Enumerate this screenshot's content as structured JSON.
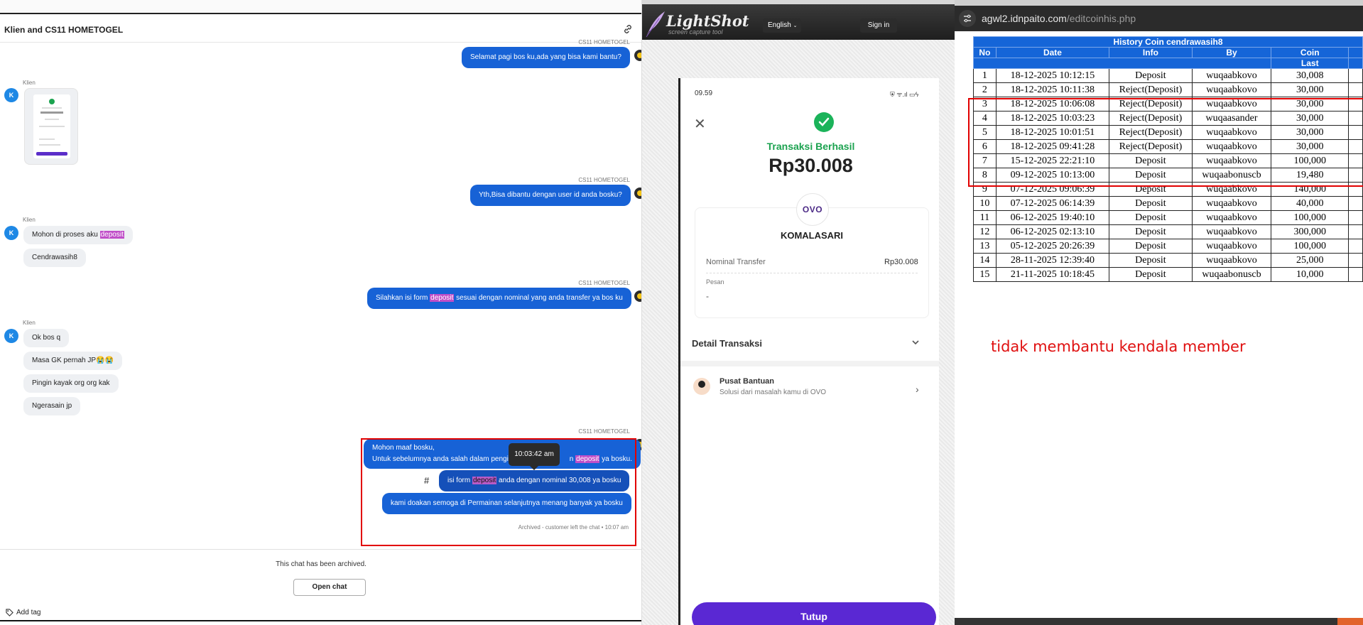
{
  "chat": {
    "title": "Klien and CS11 HOMETOGEL",
    "agent_name": "CS11 HOMETOGEL",
    "client_name": "Klien",
    "avatar_letter": "K",
    "msg1": "Selamat pagi bos ku,ada yang bisa kami bantu?",
    "msg2": "Yth,Bisa dibantu dengan user id anda bosku?",
    "msg3_pre": "Mohon di proses aku ",
    "msg3_hl": "deposit",
    "msg4": "Cendrawasih8",
    "msg5_pre": "Silahkan isi form ",
    "msg5_hl": "deposit",
    "msg5_post": " sesuai dengan nominal yang anda transfer ya bos ku",
    "msg6": "Ok bos q",
    "msg7": "Masa GK pernah JP😭😭",
    "msg8": "Pingin kayak org org kak",
    "msg9": "Ngerasain jp",
    "msg10_line1": "Mohon maaf bosku,",
    "msg10_line2_pre": "Untuk sebelumnya anda salah dalam pengi",
    "msg10_line2_mid": "n ",
    "msg10_hl": "deposit",
    "msg10_line2_post": " ya bosku.",
    "msg11_pre": "isi form ",
    "msg11_hl": "deposit",
    "msg11_post": " anda dengan nominal 30,008 ya bosku",
    "msg12": "kami doakan semoga di Permainan selanjutnya menang banyak ya bosku",
    "tooltip_time": "10:03:42 am",
    "hash_symbol": "#",
    "archived_note": "Archived - customer left the chat • 10:07 am",
    "archived_text": "This chat has been archived.",
    "open_chat_label": "Open chat",
    "add_tag_label": "Add tag"
  },
  "lightshot": {
    "logo": "LightShot",
    "tagline": "screen capture tool",
    "language": "English",
    "sign_in": "Sign in"
  },
  "receipt": {
    "time": "09.59",
    "status_icons": "⛨ ᯤ.ıl ▭ϟ",
    "success_text": "Transaksi Berhasil",
    "amount": "Rp30.008",
    "wallet_logo": "OVO",
    "recipient": "KOMALASARI",
    "transfer_label": "Nominal Transfer",
    "transfer_value": "Rp30.008",
    "message_label": "Pesan",
    "message_value": "-",
    "detail_label": "Detail Transaksi",
    "help_title": "Pusat Bantuan",
    "help_subtitle": "Solusi dari masalah kamu di OVO",
    "close_button": "Tutup"
  },
  "browser": {
    "url_host": "agwl2.idnpaito.com",
    "url_path": "/editcoinhis.php"
  },
  "history": {
    "title": "History Coin cendrawasih8",
    "headers": [
      "No",
      "Date",
      "Info",
      "By",
      "Coin"
    ],
    "subheader_coin": "Last",
    "rows": [
      [
        "1",
        "18-12-2025 10:12:15",
        "Deposit",
        "wuqaabkovo",
        "30,008"
      ],
      [
        "2",
        "18-12-2025 10:11:38",
        "Reject(Deposit)",
        "wuqaabkovo",
        "30,000"
      ],
      [
        "3",
        "18-12-2025 10:06:08",
        "Reject(Deposit)",
        "wuqaabkovo",
        "30,000"
      ],
      [
        "4",
        "18-12-2025 10:03:23",
        "Reject(Deposit)",
        "wuqaasander",
        "30,000"
      ],
      [
        "5",
        "18-12-2025 10:01:51",
        "Reject(Deposit)",
        "wuqaabkovo",
        "30,000"
      ],
      [
        "6",
        "18-12-2025 09:41:28",
        "Reject(Deposit)",
        "wuqaabkovo",
        "30,000"
      ],
      [
        "7",
        "15-12-2025 22:21:10",
        "Deposit",
        "wuqaabkovo",
        "100,000"
      ],
      [
        "8",
        "09-12-2025 10:13:00",
        "Deposit",
        "wuqaabonuscb",
        "19,480"
      ],
      [
        "9",
        "07-12-2025 09:06:39",
        "Deposit",
        "wuqaabkovo",
        "140,000"
      ],
      [
        "10",
        "07-12-2025 06:14:39",
        "Deposit",
        "wuqaabkovo",
        "40,000"
      ],
      [
        "11",
        "06-12-2025 19:40:10",
        "Deposit",
        "wuqaabkovo",
        "100,000"
      ],
      [
        "12",
        "06-12-2025 02:13:10",
        "Deposit",
        "wuqaabkovo",
        "300,000"
      ],
      [
        "13",
        "05-12-2025 20:26:39",
        "Deposit",
        "wuqaabkovo",
        "100,000"
      ],
      [
        "14",
        "28-11-2025 12:39:40",
        "Deposit",
        "wuqaabkovo",
        "25,000"
      ],
      [
        "15",
        "21-11-2025 10:18:45",
        "Deposit",
        "wuqaabonuscb",
        "10,000"
      ]
    ],
    "annotation": "tidak membantu kendala member"
  },
  "colors": {
    "agent_bubble": "#1762d6",
    "client_bubble": "#eef0f3",
    "highlight": "#c04ec8",
    "annotation_red": "#e20000",
    "table_header": "#1565d8",
    "success_green": "#1ba24f",
    "ovo_purple": "#5a28d3"
  }
}
